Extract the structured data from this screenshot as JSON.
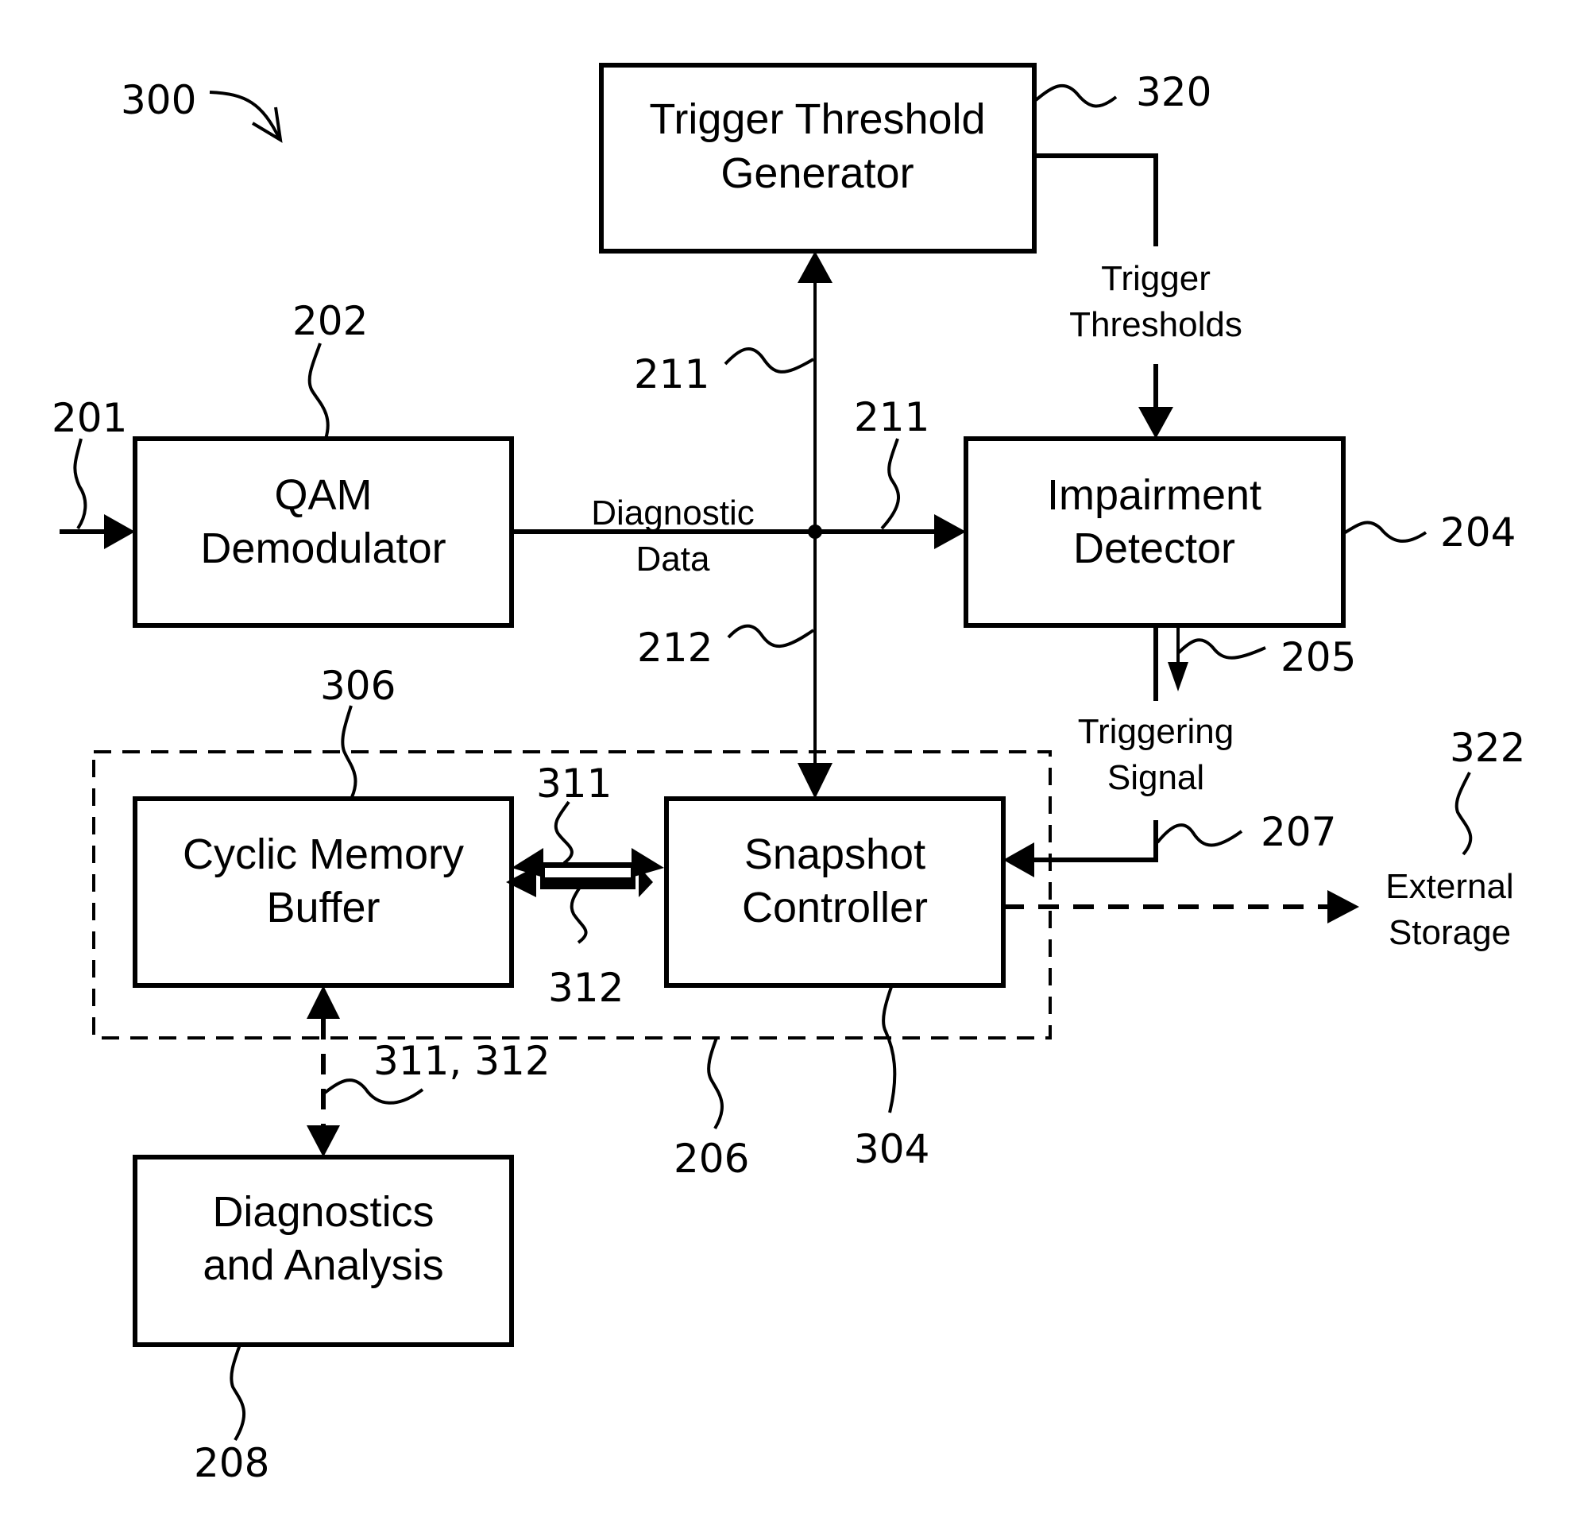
{
  "figure": {
    "number": "300",
    "blocks": {
      "trigger_threshold_generator": {
        "lines": [
          "Trigger Threshold",
          "Generator"
        ],
        "ref": "320"
      },
      "qam_demodulator": {
        "lines": [
          "QAM",
          "Demodulator"
        ],
        "ref": "202"
      },
      "impairment_detector": {
        "lines": [
          "Impairment",
          "Detector"
        ],
        "ref": "204"
      },
      "cyclic_memory_buffer": {
        "lines": [
          "Cyclic Memory",
          "Buffer"
        ],
        "ref": "306"
      },
      "snapshot_controller": {
        "lines": [
          "Snapshot",
          "Controller"
        ],
        "ref": "304"
      },
      "diagnostics_analysis": {
        "lines": [
          "Diagnostics",
          "and Analysis"
        ],
        "ref": "208"
      }
    },
    "group": {
      "ref": "206"
    },
    "signals": {
      "input": {
        "ref": "201"
      },
      "diagnostic_data": {
        "lines": [
          "Diagnostic",
          "Data"
        ],
        "ref_up": "211",
        "ref_right": "211",
        "ref_down": "212"
      },
      "trigger_thresholds": {
        "lines": [
          "Trigger",
          "Thresholds"
        ]
      },
      "triggering_signal": {
        "lines": [
          "Triggering",
          "Signal"
        ],
        "ref_out": "205",
        "ref_in": "207"
      },
      "buffer_link": {
        "ref_top": "311",
        "ref_bottom": "312"
      },
      "analysis_link": {
        "ref": "311, 312"
      },
      "external_storage": {
        "lines": [
          "External",
          "Storage"
        ],
        "ref": "322"
      }
    }
  }
}
